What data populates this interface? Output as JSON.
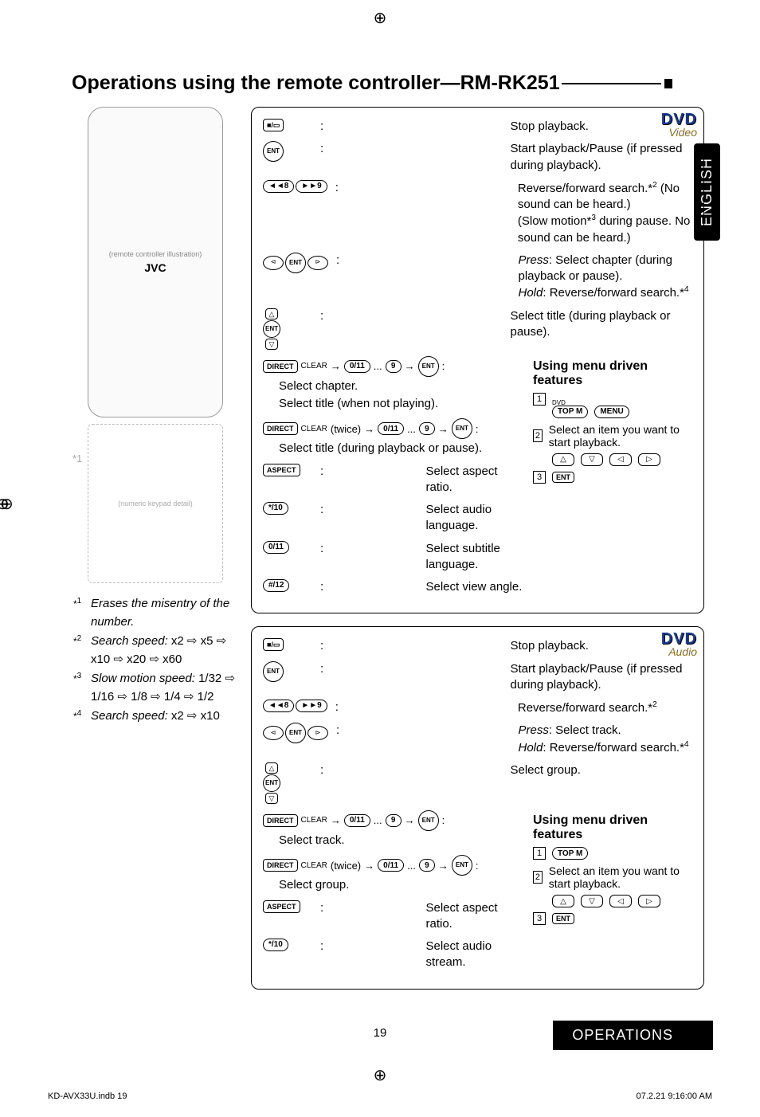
{
  "page": {
    "title": "Operations using the remote controller—RM-RK251",
    "language_tab": "ENGLISH",
    "page_number": "19",
    "section_label": "OPERATIONS",
    "file_id": "KD-AVX33U.indb   19",
    "timestamp": "07.2.21   9:16:00 AM"
  },
  "remote": {
    "brand": "JVC",
    "placeholder": "(remote controller illustration)",
    "small_placeholder": "(numeric keypad detail)",
    "star1": "*1"
  },
  "footnotes": {
    "f1": {
      "marker": "*1",
      "text": "Erases the misentry of the number."
    },
    "f2": {
      "marker": "*2",
      "prefix": "Search speed: ",
      "seq": "x2 ⇨ x5 ⇨ x10 ⇨ x20 ⇨ x60"
    },
    "f3": {
      "marker": "*3",
      "prefix": "Slow motion speed: ",
      "seq": "1/32 ⇨ 1/16 ⇨ 1/8 ⇨ 1/4 ⇨ 1/2"
    },
    "f4": {
      "marker": "*4",
      "prefix": "Search speed: ",
      "seq": "x2 ⇨ x10"
    }
  },
  "panel_video": {
    "badge_title": "DVD",
    "badge_sub": "Video",
    "stop": "Stop playback.",
    "play_pause": "Start playback/Pause (if pressed during playback).",
    "rev_fwd": "Reverse/forward search.*2 (No sound can be heard.) (Slow motion*3 during pause. No sound can be heard.)",
    "press_hold_1": "Press",
    "press_hold_1b": ": Select chapter (during playback or pause).",
    "press_hold_2": "Hold",
    "press_hold_2b": ": Reverse/forward search.*4",
    "select_title_pause": "Select title (during playback or pause).",
    "select_chapter": "Select chapter.",
    "select_title_notplay": "Select title (when not playing).",
    "twice": "(twice)",
    "select_title_pause2": "Select title (during playback or pause).",
    "aspect": "Select aspect ratio.",
    "audio_lang": "Select audio language.",
    "subtitle_lang": "Select subtitle language.",
    "view_angle": "Select view angle.",
    "menu_title": "Using menu driven features",
    "menu_step2": "Select an item you want to start playback."
  },
  "panel_audio": {
    "badge_title": "DVD",
    "badge_sub": "Audio",
    "stop": "Stop playback.",
    "play_pause": "Start playback/Pause (if pressed during playback).",
    "rev_fwd": "Reverse/forward search.*2",
    "press_hold_1": "Press",
    "press_hold_1b": ": Select track.",
    "press_hold_2": "Hold",
    "press_hold_2b": ": Reverse/forward search.*4",
    "select_group": "Select group.",
    "select_track": "Select track.",
    "twice": "(twice)",
    "select_group2": "Select group.",
    "aspect": "Select aspect ratio.",
    "audio_stream": "Select audio stream.",
    "menu_title": "Using menu driven features",
    "menu_step2": "Select an item you want to start playback."
  },
  "buttons": {
    "ent": "ENT",
    "direct": "DIRECT",
    "clear": "CLEAR",
    "aspect": "ASPECT",
    "topm": "TOP M",
    "menu": "MENU",
    "dvd_label": "DVD",
    "num0": "0/11",
    "num9": "9",
    "num8": "8",
    "audio10": "*/10",
    "sub_lang": "0/11",
    "angle": "#/12"
  }
}
